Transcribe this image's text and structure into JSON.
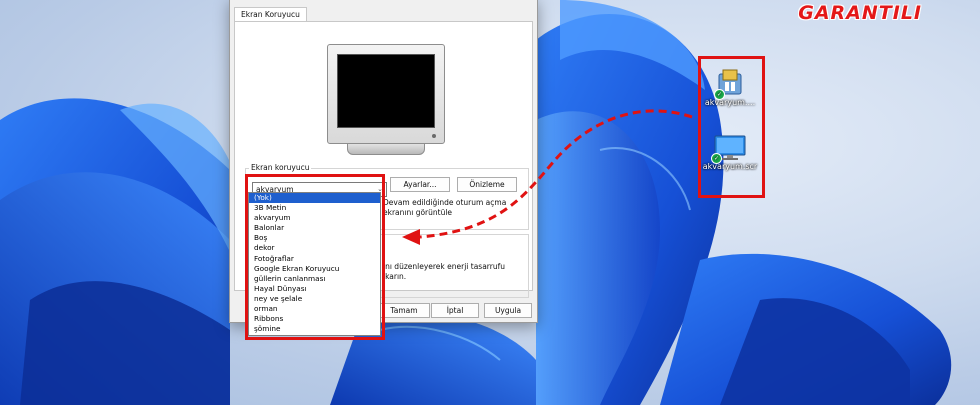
{
  "brand_text": "GARANTILI",
  "dialog": {
    "tab_label": "Ekran Koruyucu",
    "group_title": "Ekran koruyucu",
    "selected_saver": "akvaryum",
    "settings_button": "Ayarlar...",
    "preview_button": "Önizleme",
    "resume_text_line1": "Devam edildiğinde oturum açma",
    "resume_text_line2": "ekranını görüntüle",
    "energy_text_line1": "ını düzenleyerek enerji tasarrufu",
    "energy_text_line2": "ıkarın.",
    "ok_button": "Tamam",
    "cancel_button": "İptal",
    "apply_button": "Uygula"
  },
  "dropdown_items": [
    "(Yok)",
    "3B Metin",
    "akvaryum",
    "Balonlar",
    "Boş",
    "dekor",
    "Fotoğraflar",
    "Google Ekran Koruyucu",
    "güllerin canlanması",
    "Hayal Dünyası",
    "ney ve şelale",
    "orman",
    "Ribbons",
    "şömine"
  ],
  "dropdown_highlighted_index": 0,
  "desktop_icons": [
    {
      "label": "akvaryum....",
      "icon": "installer-icon"
    },
    {
      "label": "akvaryum.scr",
      "icon": "monitor-icon"
    }
  ],
  "colors": {
    "highlight_red": "#e01212",
    "selection_blue": "#1e5fce",
    "wallpaper_blue": "#1a4fd8"
  }
}
